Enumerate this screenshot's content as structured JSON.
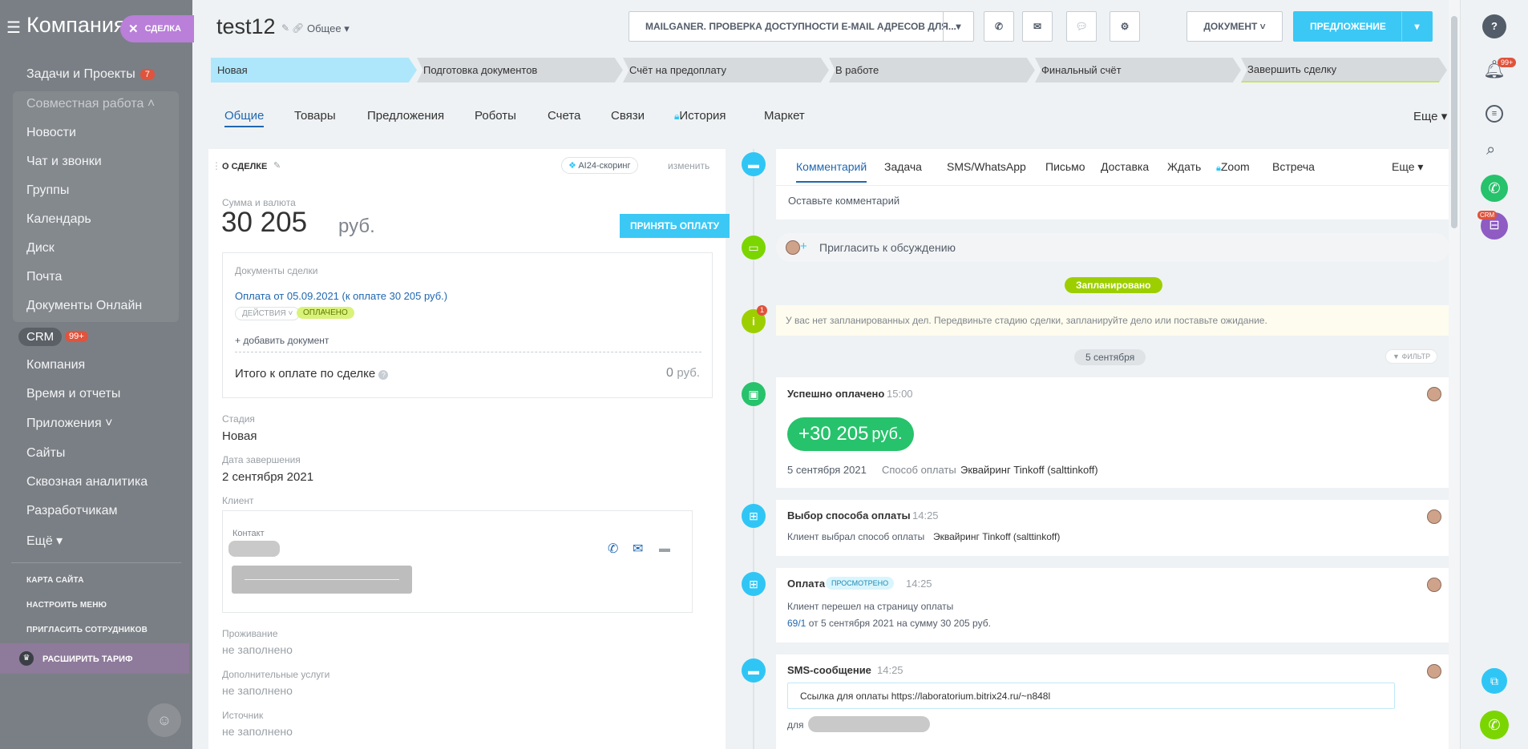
{
  "left_menu": {
    "title": "Компания",
    "items": [
      "Задачи и Проекты",
      "Совместная работа",
      "Новости",
      "Чат и звонки",
      "Группы",
      "Календарь",
      "Диск",
      "Почта",
      "Документы Онлайн"
    ],
    "tasks_badge": "7",
    "crm_label": "CRM",
    "crm_badge": "99+",
    "items2": [
      "Компания",
      "Время и отчеты",
      "Приложения",
      "Сайты",
      "Сквозная аналитика",
      "Разработчикам",
      "Ещё"
    ],
    "small_links": [
      "КАРТА САЙТА",
      "НАСТРОИТЬ МЕНЮ",
      "ПРИГЛАСИТЬ СОТРУДНИКОВ"
    ],
    "upgrade_label": "РАСШИРИТЬ ТАРИФ"
  },
  "deal_chip": "СДЕЛКА",
  "header": {
    "title": "test12",
    "category": "Общее",
    "app_button": "MAILGANER. ПРОВЕРКА ДОСТУПНОСТИ E-MAIL АДРЕСОВ ДЛЯ...",
    "document_button": "ДОКУМЕНТ",
    "proposal_button": "ПРЕДЛОЖЕНИЕ"
  },
  "stages": [
    "Новая",
    "Подготовка документов",
    "Счёт на предоплату",
    "В работе",
    "Финальный счёт",
    "Завершить сделку"
  ],
  "tabs": [
    "Общие",
    "Товары",
    "Предложения",
    "Роботы",
    "Счета",
    "Связи",
    "История",
    "Маркет"
  ],
  "tabs_more": "Еще",
  "about": {
    "title": "О СДЕЛКЕ",
    "ai_scoring": "AI24-скоринг",
    "edit": "изменить",
    "sum_label": "Сумма и валюта",
    "sum_value": "30 205",
    "currency": "руб.",
    "accept_payment": "ПРИНЯТЬ ОПЛАТУ",
    "docs_title": "Документы сделки",
    "doc_link": "Оплата от 05.09.2021 (к оплате 30 205 руб.)",
    "actions": "ДЕЙСТВИЯ",
    "paid": "ОПЛАЧЕНО",
    "add_doc": "+ добавить документ",
    "total_label": "Итого к оплате по сделке",
    "total_value": "0",
    "total_currency": "руб.",
    "stage_label": "Стадия",
    "stage_value": "Новая",
    "close_label": "Дата завершения",
    "close_value": "2 сентября 2021",
    "client_label": "Клиент",
    "contact_label": "Контакт",
    "living_label": "Проживание",
    "living_value": "не заполнено",
    "services_label": "Дополнительные услуги",
    "services_value": "не заполнено",
    "source_label": "Источник",
    "source_value": "не заполнено"
  },
  "activity": {
    "tabs": [
      "Комментарий",
      "Задача",
      "SMS/WhatsApp",
      "Письмо",
      "Доставка",
      "Ждать",
      "Zoom",
      "Встреча"
    ],
    "more": "Еще",
    "comment_placeholder": "Оставьте комментарий",
    "invite": "Пригласить к обсуждению",
    "planned": "Запланировано",
    "planned_badge": "1",
    "no_tasks": "У вас нет запланированных дел. Передвиньте стадию сделки, запланируйте дело или поставьте ожидание.",
    "date_sep": "5 сентября",
    "filter": "ФИЛЬТР"
  },
  "timeline": {
    "paid_title": "Успешно оплачено",
    "paid_time": "15:00",
    "paid_amount": "+30 205",
    "paid_currency": "руб.",
    "paid_date": "5 сентября 2021",
    "paid_method_label": "Способ оплаты",
    "paid_method": "Эквайринг Tinkoff (salttinkoff)",
    "choice_title": "Выбор способа оплаты",
    "choice_time": "14:25",
    "choice_text": "Клиент выбрал способ оплаты",
    "choice_method": "Эквайринг Tinkoff (salttinkoff)",
    "pay_title": "Оплата",
    "pay_viewed": "ПРОСМОТРЕНО",
    "pay_time": "14:25",
    "pay_text": "Клиент перешел на страницу оплаты",
    "pay_link": "69/1",
    "pay_rest": "от 5 сентября 2021 на сумму 30 205 руб.",
    "sms_title": "SMS-сообщение",
    "sms_time": "14:25",
    "sms_text": "Ссылка для оплаты https://laboratorium.bitrix24.ru/~n848l",
    "sms_for": "для"
  },
  "right_panel": {
    "notif_badge": "99+",
    "crm_tag": "CRM"
  },
  "colors": {
    "accent": "#2fc6f6",
    "green": "#7bd500",
    "paid_green": "#27c26c",
    "blue_link": "#2067b0"
  }
}
